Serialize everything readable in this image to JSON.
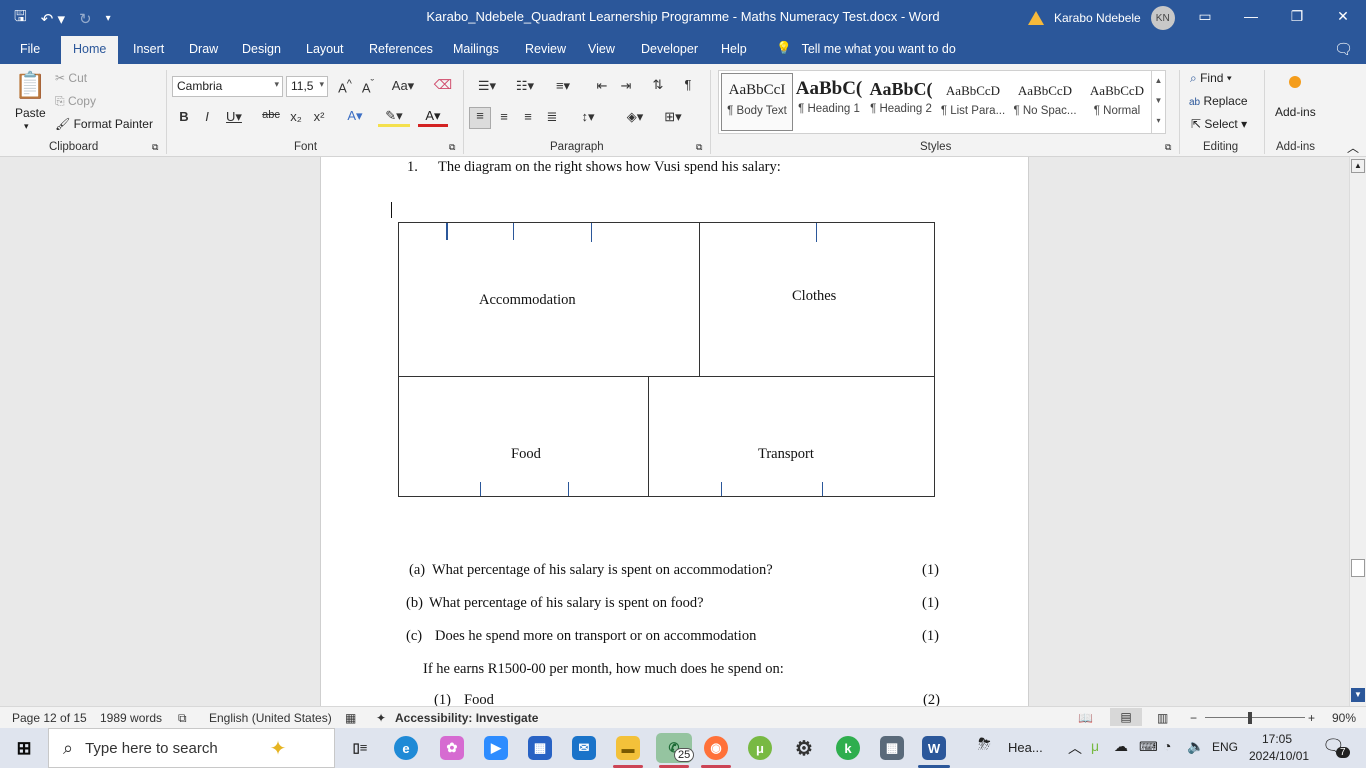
{
  "app": {
    "doc_title": "Karabo_Ndebele_Quadrant Learnership Programme - Maths Numeracy Test.docx  -  Word",
    "user_name": "Karabo Ndebele",
    "user_initials": "KN"
  },
  "tabs": [
    "File",
    "Home",
    "Insert",
    "Draw",
    "Design",
    "Layout",
    "References",
    "Mailings",
    "Review",
    "View",
    "Developer",
    "Help"
  ],
  "tell_me": "Tell me what you want to do",
  "ribbon": {
    "clipboard": {
      "paste": "Paste",
      "cut": "Cut",
      "copy": "Copy",
      "format_painter": "Format Painter",
      "label": "Clipboard"
    },
    "font": {
      "family": "Cambria",
      "size": "11,5",
      "label": "Font"
    },
    "paragraph": {
      "label": "Paragraph"
    },
    "styles": {
      "label": "Styles",
      "items": [
        {
          "preview": "AaBbCcI",
          "name": "¶ Body Text"
        },
        {
          "preview": "AaBbC(",
          "name": "¶ Heading 1"
        },
        {
          "preview": "AaBbC(",
          "name": "¶ Heading 2"
        },
        {
          "preview": "AaBbCcD",
          "name": "¶ List Para..."
        },
        {
          "preview": "AaBbCcD",
          "name": "¶ No Spac..."
        },
        {
          "preview": "AaBbCcD",
          "name": "¶ Normal"
        }
      ]
    },
    "editing": {
      "find": "Find",
      "replace": "Replace",
      "select": "Select",
      "label": "Editing"
    },
    "addins": {
      "addins": "Add-ins",
      "label": "Add-ins"
    }
  },
  "document": {
    "q1_num": "1.",
    "q1_text": "The diagram on the right shows how Vusi spend his salary:",
    "diagram": {
      "accommodation": "Accommodation",
      "clothes": "Clothes",
      "food": "Food",
      "transport": "Transport"
    },
    "qa_label": "(a)",
    "qa_text": "What percentage of his salary is spent on accommodation?",
    "qa_marks": "(1)",
    "qb_label": "(b)",
    "qb_text": "What percentage of his salary is spent on food?",
    "qb_marks": "(1)",
    "qc_label": "(c)",
    "qc_text": "Does he spend more on transport or on accommodation",
    "qc_marks": "(1)",
    "earn_text": "If he earns R1500-00 per month, how much does he spend on:",
    "q1_sub_label": "(1)",
    "q1_sub_text": "Food",
    "q1_sub_marks": "(2)"
  },
  "status": {
    "page": "Page 12 of 15",
    "words": "1989 words",
    "language": "English (United States)",
    "accessibility": "Accessibility: Investigate",
    "zoom": "90%"
  },
  "taskbar": {
    "search_placeholder": "Type here to search",
    "whatsapp_badge": "25",
    "weather": "Hea...",
    "lang": "ENG",
    "time": "17:05",
    "date": "2024/10/01",
    "notifications": "7"
  }
}
